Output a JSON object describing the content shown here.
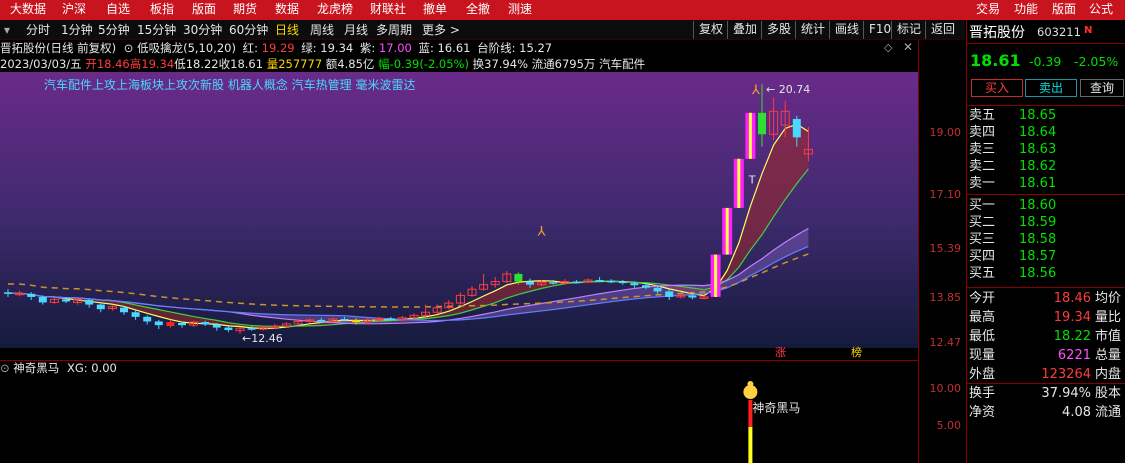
{
  "topmenu": [
    "大数据",
    "沪深",
    "自选",
    "板指",
    "版面",
    "期货",
    "数据",
    "龙虎榜",
    "财联社",
    "撤单",
    "全撤",
    "测速",
    "交易",
    "功能",
    "版面",
    "公式"
  ],
  "periods": [
    "分时",
    "1分钟",
    "5分钟",
    "15分钟",
    "30分钟",
    "60分钟",
    "日线",
    "周线",
    "月线",
    "多周期",
    "更多 >"
  ],
  "toolbar": [
    "复权",
    "叠加",
    "多股",
    "统计",
    "画线",
    "F10",
    "标记",
    "返回"
  ],
  "header": {
    "stock": "晋拓股份(日线 前复权)",
    "indicator": "低吸擒龙(5,10,20)",
    "red_label": "红: ",
    "red_val": "19.29",
    "green_label": "绿: ",
    "green_val": "19.34",
    "purple_label": "紫: ",
    "purple_val": "17.00",
    "blue_label": "蓝: ",
    "blue_val": "16.61",
    "step_label": "台阶线: ",
    "step_val": "15.27",
    "date": "2023/03/03/五",
    "open": "开18.46",
    "high": "高19.34",
    "low": "低18.22",
    "close": "收18.61",
    "vol": "量257777",
    "amt": "额4.85亿",
    "amp": "幅-0.39(-2.05%)",
    "turn": "换37.94%",
    "float": "流通6795万",
    "sector": "汽车配件"
  },
  "concepts": "汽车配件上攻上海板块上攻次新股 机器人概念 汽车热管理 毫米波雷达",
  "annotations": {
    "high_mark": "20.74",
    "low_mark": "12.46",
    "t_mark": "T",
    "tag_zhang": "涨",
    "tag_bang": "榜",
    "signal_label": "神奇黑马"
  },
  "axis_main": [
    "19.00",
    "17.10",
    "15.39",
    "13.85",
    "12.47"
  ],
  "axis_lower": [
    "10.00",
    "5.00"
  ],
  "lower_header": {
    "name": "神奇黑马",
    "xg": "XG: 0.00"
  },
  "quote": {
    "name": "晋拓股份",
    "code": "603211",
    "badge": "N",
    "price": "18.61",
    "change": "-0.39",
    "change_pct": "-2.05%",
    "buy_btn": "买入",
    "sell_btn": "卖出",
    "query_btn": "查询",
    "asks": [
      {
        "label": "卖五",
        "price": "18.65"
      },
      {
        "label": "卖四",
        "price": "18.64"
      },
      {
        "label": "卖三",
        "price": "18.63"
      },
      {
        "label": "卖二",
        "price": "18.62"
      },
      {
        "label": "卖一",
        "price": "18.61"
      }
    ],
    "bids": [
      {
        "label": "买一",
        "price": "18.60"
      },
      {
        "label": "买二",
        "price": "18.59"
      },
      {
        "label": "买三",
        "price": "18.58"
      },
      {
        "label": "买四",
        "price": "18.57"
      },
      {
        "label": "买五",
        "price": "18.56"
      }
    ],
    "stats": [
      {
        "l1": "今开",
        "v1": "18.46",
        "c1": "#ff3c3c",
        "l2": "均价"
      },
      {
        "l1": "最高",
        "v1": "19.34",
        "c1": "#ff3c3c",
        "l2": "量比"
      },
      {
        "l1": "最低",
        "v1": "18.22",
        "c1": "#00e000",
        "l2": "市值"
      },
      {
        "l1": "现量",
        "v1": "6221",
        "c1": "#ff50ff",
        "l2": "总量"
      },
      {
        "l1": "外盘",
        "v1": "123264",
        "c1": "#ff3c3c",
        "l2": "内盘"
      },
      {
        "l1": "换手",
        "v1": "37.94%",
        "c1": "#e6e6e6",
        "l2": "股本"
      },
      {
        "l1": "净资",
        "v1": "4.08",
        "c1": "#e6e6e6",
        "l2": "流通"
      }
    ]
  },
  "colors": {
    "menu_bg": "#c8141e",
    "up": "#ff3c3c",
    "down": "#4ad8ff",
    "chart_top": "#6a2a8a",
    "chart_bottom": "#141a3c"
  },
  "chart_data": {
    "type": "candlestick",
    "price_range": [
      12.2,
      21.0
    ],
    "candles": [
      [
        13.95,
        13.92,
        14.05,
        13.8,
        "d"
      ],
      [
        13.9,
        13.92,
        14.0,
        13.82,
        "u"
      ],
      [
        13.9,
        13.8,
        13.95,
        13.7,
        "d"
      ],
      [
        13.8,
        13.62,
        13.85,
        13.55,
        "d"
      ],
      [
        13.62,
        13.72,
        13.78,
        13.58,
        "u"
      ],
      [
        13.72,
        13.65,
        13.8,
        13.6,
        "d"
      ],
      [
        13.62,
        13.72,
        13.75,
        13.55,
        "u"
      ],
      [
        13.7,
        13.55,
        13.72,
        13.45,
        "d"
      ],
      [
        13.55,
        13.4,
        13.6,
        13.3,
        "d"
      ],
      [
        13.42,
        13.48,
        13.55,
        13.35,
        "u"
      ],
      [
        13.45,
        13.3,
        13.5,
        13.22,
        "d"
      ],
      [
        13.3,
        13.15,
        13.35,
        13.05,
        "d"
      ],
      [
        13.15,
        13.0,
        13.2,
        12.9,
        "d"
      ],
      [
        13.0,
        12.88,
        13.05,
        12.75,
        "d"
      ],
      [
        12.85,
        12.98,
        13.05,
        12.8,
        "r"
      ],
      [
        12.95,
        12.88,
        13.0,
        12.8,
        "d"
      ],
      [
        12.88,
        12.98,
        13.02,
        12.82,
        "u"
      ],
      [
        12.98,
        12.9,
        13.02,
        12.85,
        "d"
      ],
      [
        12.9,
        12.8,
        12.95,
        12.7,
        "d"
      ],
      [
        12.8,
        12.72,
        12.85,
        12.65,
        "d"
      ],
      [
        12.7,
        12.78,
        12.82,
        12.6,
        "u"
      ],
      [
        12.78,
        12.75,
        12.85,
        12.7,
        "d"
      ],
      [
        12.75,
        12.8,
        12.85,
        12.7,
        "u"
      ],
      [
        12.8,
        12.85,
        12.92,
        12.75,
        "u"
      ],
      [
        12.85,
        12.92,
        12.98,
        12.8,
        "u"
      ],
      [
        12.92,
        13.0,
        13.05,
        12.88,
        "u"
      ],
      [
        13.0,
        13.05,
        13.1,
        12.95,
        "u"
      ],
      [
        13.05,
        13.0,
        13.12,
        12.95,
        "d"
      ],
      [
        13.0,
        13.08,
        13.12,
        12.95,
        "u"
      ],
      [
        13.08,
        13.05,
        13.15,
        13.0,
        "d"
      ],
      [
        13.05,
        12.98,
        13.1,
        12.9,
        "y"
      ],
      [
        12.98,
        13.05,
        13.1,
        12.92,
        "u"
      ],
      [
        13.05,
        13.1,
        13.15,
        13.0,
        "u"
      ],
      [
        13.1,
        13.05,
        13.15,
        13.02,
        "d"
      ],
      [
        13.05,
        13.12,
        13.18,
        13.0,
        "u"
      ],
      [
        13.12,
        13.2,
        13.26,
        13.08,
        "u"
      ],
      [
        13.2,
        13.3,
        13.55,
        13.15,
        "u"
      ],
      [
        13.3,
        13.45,
        13.55,
        13.25,
        "u"
      ],
      [
        13.45,
        13.6,
        13.7,
        13.4,
        "u"
      ],
      [
        13.6,
        13.85,
        13.95,
        13.55,
        "u"
      ],
      [
        13.85,
        14.05,
        14.15,
        13.8,
        "u"
      ],
      [
        14.05,
        14.2,
        14.55,
        14.0,
        "u"
      ],
      [
        14.2,
        14.3,
        14.45,
        14.1,
        "u"
      ],
      [
        14.3,
        14.55,
        14.65,
        14.25,
        "u"
      ],
      [
        14.55,
        14.3,
        14.6,
        14.2,
        "g"
      ],
      [
        14.3,
        14.2,
        14.4,
        14.1,
        "d"
      ],
      [
        14.2,
        14.28,
        14.35,
        14.15,
        "u"
      ],
      [
        14.28,
        14.25,
        14.35,
        14.2,
        "d"
      ],
      [
        14.25,
        14.3,
        14.38,
        14.2,
        "u"
      ],
      [
        14.3,
        14.28,
        14.35,
        14.25,
        "d"
      ],
      [
        14.28,
        14.35,
        14.4,
        14.25,
        "u"
      ],
      [
        14.35,
        14.32,
        14.45,
        14.28,
        "d"
      ],
      [
        14.32,
        14.3,
        14.38,
        14.25,
        "d"
      ],
      [
        14.3,
        14.25,
        14.35,
        14.2,
        "d"
      ],
      [
        14.25,
        14.18,
        14.3,
        14.1,
        "d"
      ],
      [
        14.18,
        14.1,
        14.22,
        14.05,
        "d"
      ],
      [
        14.1,
        13.98,
        14.15,
        13.9,
        "d"
      ],
      [
        13.98,
        13.8,
        14.05,
        13.7,
        "d"
      ],
      [
        13.8,
        13.85,
        13.9,
        13.75,
        "u"
      ],
      [
        13.85,
        13.78,
        13.9,
        13.72,
        "d"
      ],
      [
        13.78,
        13.8,
        13.85,
        13.72,
        "u"
      ],
      [
        13.8,
        15.18,
        15.18,
        13.8,
        "m"
      ],
      [
        15.18,
        16.7,
        16.7,
        15.18,
        "m"
      ],
      [
        16.7,
        18.3,
        18.3,
        16.7,
        "m"
      ],
      [
        18.3,
        19.8,
        19.8,
        18.3,
        "m"
      ],
      [
        19.8,
        19.1,
        20.74,
        18.7,
        "g"
      ],
      [
        19.1,
        19.85,
        20.3,
        18.9,
        "u"
      ],
      [
        19.85,
        19.4,
        20.2,
        19.0,
        "u"
      ],
      [
        19.6,
        19.0,
        19.7,
        18.7,
        "d"
      ],
      [
        18.46,
        18.61,
        19.34,
        18.22,
        "u"
      ]
    ],
    "xg": 0.0
  }
}
